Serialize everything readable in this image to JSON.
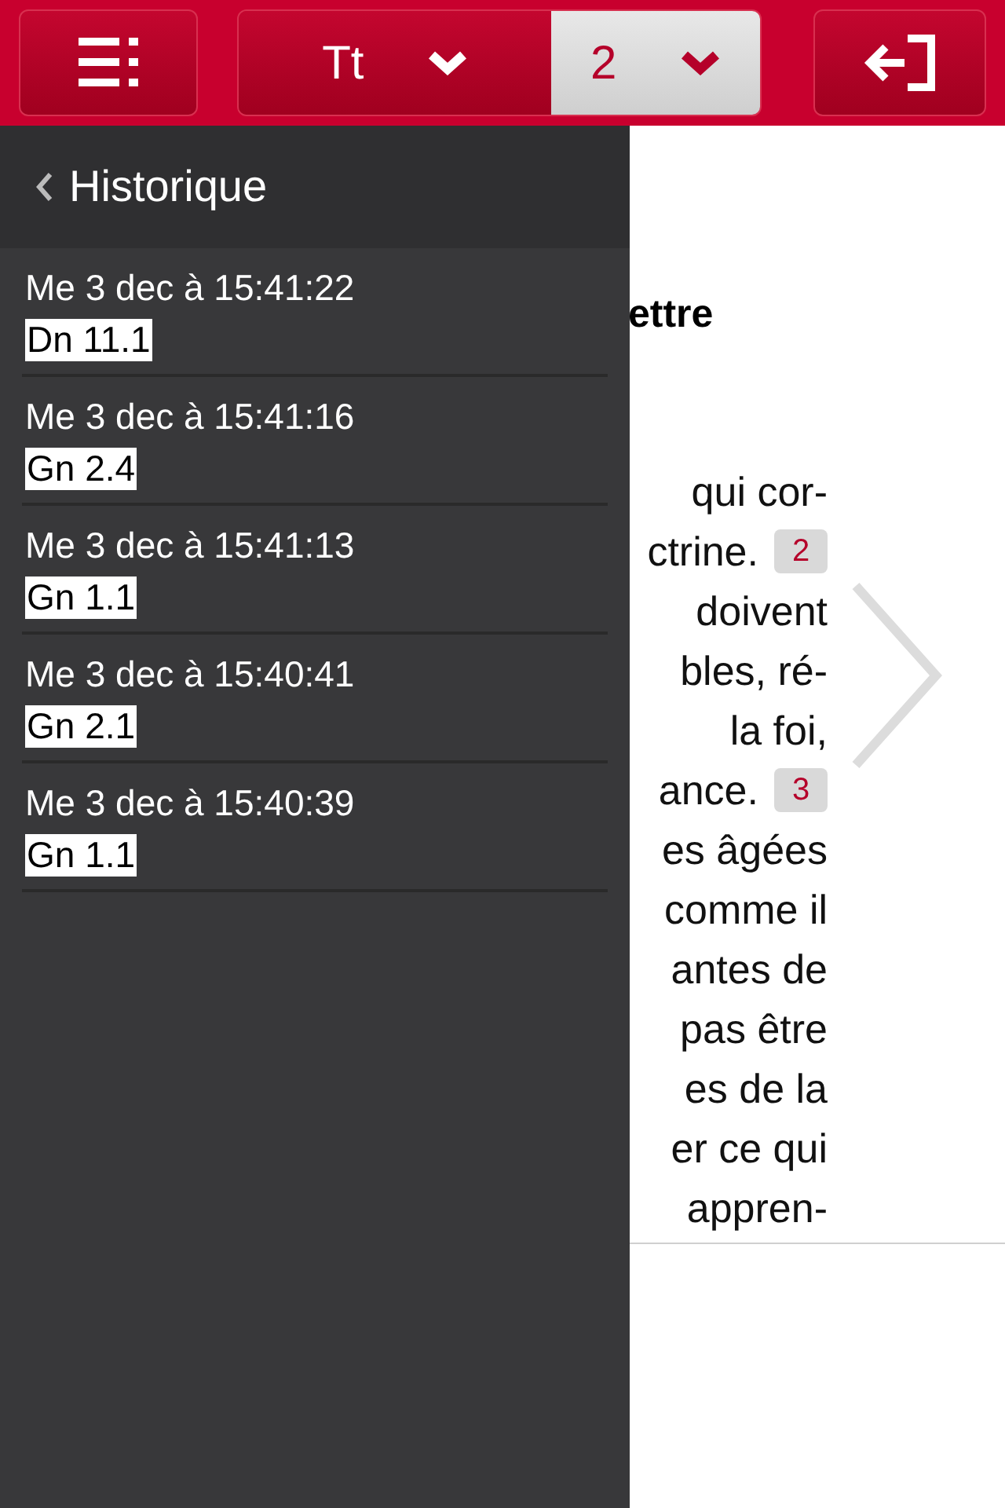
{
  "toolbar": {
    "segments": [
      {
        "label": "Tt",
        "selected": false
      },
      {
        "label": "2",
        "selected": true
      }
    ]
  },
  "reader": {
    "heading": "ettre",
    "lines": [
      {
        "text": "qui cor-"
      },
      {
        "text": "ctrine.",
        "verse": "2"
      },
      {
        "text": "doivent"
      },
      {
        "text": "bles, ré-"
      },
      {
        "text": "la foi,"
      },
      {
        "text": "ance.",
        "verse": "3"
      },
      {
        "text": "es âgées"
      },
      {
        "text": "comme il"
      },
      {
        "text": "antes de"
      },
      {
        "text": "pas être"
      },
      {
        "text": "es de la"
      },
      {
        "text": "er ce qui"
      },
      {
        "text": "appren-"
      }
    ]
  },
  "history": {
    "title": "Historique",
    "items": [
      {
        "time": "Me 3 dec à 15:41:22",
        "ref": "Dn 11.1"
      },
      {
        "time": "Me 3 dec à 15:41:16",
        "ref": "Gn 2.4"
      },
      {
        "time": "Me 3 dec à 15:41:13",
        "ref": "Gn 1.1"
      },
      {
        "time": "Me 3 dec à 15:40:41",
        "ref": "Gn 2.1"
      },
      {
        "time": "Me 3 dec à 15:40:39",
        "ref": "Gn 1.1"
      }
    ]
  }
}
